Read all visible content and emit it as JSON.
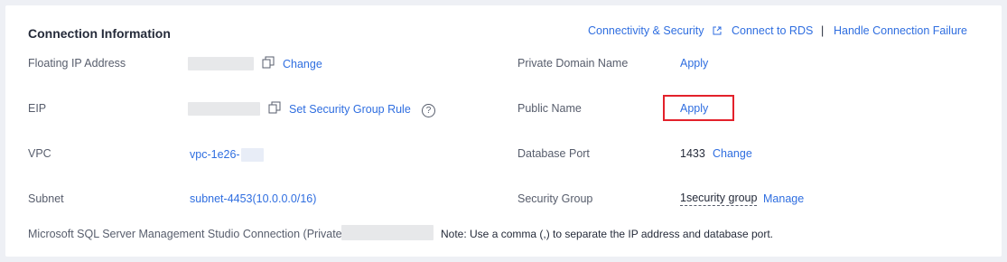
{
  "section": {
    "title": "Connection Information"
  },
  "header_links": {
    "connectivity": "Connectivity & Security",
    "connect_rds": "Connect to RDS",
    "separator": "|",
    "handle_failure": "Handle Connection Failure"
  },
  "left": {
    "floating_ip": {
      "label": "Floating IP Address",
      "action": "Change"
    },
    "eip": {
      "label": "EIP",
      "action": "Set Security Group Rule",
      "help": "?"
    },
    "vpc": {
      "label": "VPC",
      "value": "vpc-1e26-"
    },
    "subnet": {
      "label": "Subnet",
      "value": "subnet-4453(10.0.0.0/16)"
    }
  },
  "right": {
    "private_domain": {
      "label": "Private Domain Name",
      "action": "Apply"
    },
    "public_name": {
      "label": "Public Name",
      "action": "Apply"
    },
    "db_port": {
      "label": "Database Port",
      "value": "1433",
      "action": "Change"
    },
    "security_group": {
      "label": "Security Group",
      "value": "1security group",
      "action": "Manage"
    }
  },
  "ssms": {
    "label": "Microsoft SQL Server Management Studio Connection (Private)",
    "note": "Note: Use a comma (,) to separate the IP address and database port."
  },
  "colors": {
    "link": "#2f6ee0",
    "highlight": "#e3212b",
    "label": "#575d6c"
  }
}
